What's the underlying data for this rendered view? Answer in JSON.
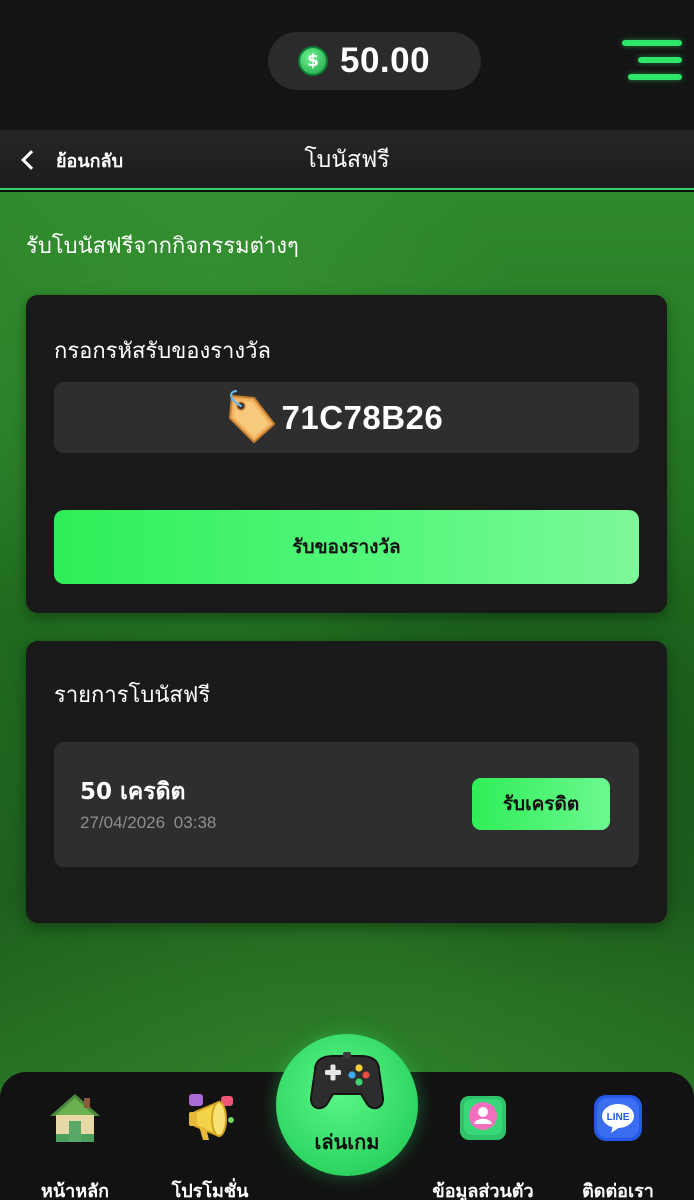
{
  "balance": {
    "value": "50.00",
    "currency_symbol": "$"
  },
  "header": {
    "back_label": "ย้อนกลับ",
    "title": "โบนัสฟรี"
  },
  "subtitle": "รับโบนัสฟรีจากกิจกรรมต่างๆ",
  "redeem": {
    "title": "กรอกรหัสรับของรางวัล",
    "code_value": "71C78B26",
    "button_label": "รับของรางวัล"
  },
  "bonus_list": {
    "title": "รายการโบนัสฟรี",
    "items": [
      {
        "amount": "50 เครดิต",
        "date": "27/04/2026 03:38",
        "claim_label": "รับเครดิต"
      }
    ]
  },
  "nav": {
    "home": "หน้าหลัก",
    "promotions": "โปรโมชั่น",
    "play": "เล่นเกม",
    "profile": "ข้อมูลส่วนตัว",
    "contact": "ติดต่อเรา",
    "line_badge": "LINE"
  },
  "colors": {
    "accent": "#2fee58",
    "card_bg": "#191919",
    "field_bg": "#2e2e2e"
  },
  "icons": [
    "coin-icon",
    "menu-icon",
    "chevron-left-icon",
    "price-tag-icon",
    "house-icon",
    "megaphone-icon",
    "gamepad-icon",
    "profile-icon",
    "line-icon"
  ]
}
